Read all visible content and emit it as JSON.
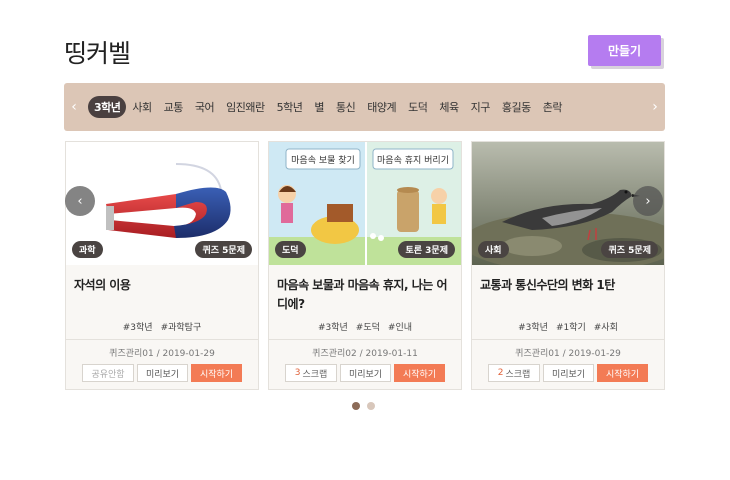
{
  "header": {
    "title": "띵커벨",
    "make_label": "만들기"
  },
  "tags": {
    "prev_icon": "chevron-left-icon",
    "next_icon": "chevron-right-icon",
    "items": [
      "3학년",
      "사회",
      "교통",
      "국어",
      "임진왜란",
      "5학년",
      "별",
      "통신",
      "태양계",
      "도덕",
      "체육",
      "지구",
      "홍길동",
      "촌락"
    ],
    "active_index": 0
  },
  "cards": [
    {
      "category": "과학",
      "quiz": "퀴즈 5문제",
      "title": "자석의 이용",
      "tags": [
        "#3학년",
        "#과학탐구"
      ],
      "meta": "퀴즈관리01 / 2019-01-29",
      "share_label": "공유안함",
      "preview_label": "미리보기",
      "start_label": "시작하기"
    },
    {
      "category": "도덕",
      "quiz": "토론 3문제",
      "title": "마음속 보물과 마음속 휴지, 나는 어디에?",
      "tags": [
        "#3학년",
        "#도덕",
        "#인내"
      ],
      "meta": "퀴즈관리02 / 2019-01-11",
      "scrap_count": "3",
      "scrap_label": "스크랩",
      "preview_label": "미리보기",
      "start_label": "시작하기",
      "image_text_left": "마음속 보물 찾기",
      "image_text_right": "마음속 휴지 버리기"
    },
    {
      "category": "사회",
      "quiz": "퀴즈 5문제",
      "title": "교통과 통신수단의 변화 1탄",
      "tags": [
        "#3학년",
        "#1학기",
        "#사회"
      ],
      "meta": "퀴즈관리01 / 2019-01-29",
      "scrap_count": "2",
      "scrap_label": "스크랩",
      "preview_label": "미리보기",
      "start_label": "시작하기"
    }
  ],
  "carousel": {
    "prev_icon": "chevron-left-icon",
    "next_icon": "chevron-right-icon",
    "page_count": 2,
    "active_page": 1
  },
  "colors": {
    "accent": "#b57cf0",
    "start": "#f37b55",
    "tagbar": "#dcc6b6",
    "badge": "#4a4442"
  }
}
